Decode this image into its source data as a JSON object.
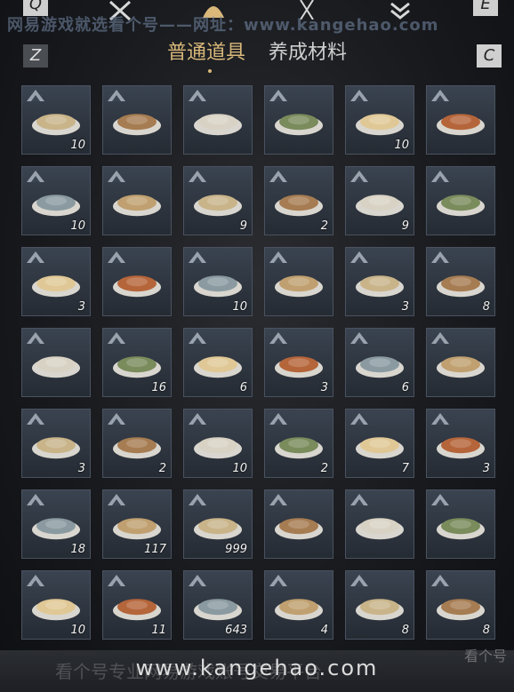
{
  "top": {
    "key_left": "Q",
    "key_right": "E",
    "watermark": "网易游戏就选看个号——网址：www.kangehao.com"
  },
  "tabs": {
    "key_left": "Z",
    "key_right": "C",
    "items": [
      {
        "label": "普通道具",
        "active": true
      },
      {
        "label": "养成材料",
        "active": false
      }
    ]
  },
  "inventory": [
    {
      "name": "plate-flatbread",
      "count": "10"
    },
    {
      "name": "braised-stew-bowl",
      "count": ""
    },
    {
      "name": "oyster-plate",
      "count": ""
    },
    {
      "name": "green-vegetable-bowl",
      "count": ""
    },
    {
      "name": "scallion-pancake",
      "count": "10"
    },
    {
      "name": "steamed-bun",
      "count": ""
    },
    {
      "name": "noodle-bowl",
      "count": "10"
    },
    {
      "name": "stir-fried-noodles",
      "count": ""
    },
    {
      "name": "fried-meat-plate",
      "count": "9"
    },
    {
      "name": "spinach-plate",
      "count": "2"
    },
    {
      "name": "rice-ball-bowl",
      "count": "9"
    },
    {
      "name": "soup-bowl",
      "count": ""
    },
    {
      "name": "braised-pork-bowl",
      "count": "3"
    },
    {
      "name": "broth-bowl",
      "count": ""
    },
    {
      "name": "tofu-plate",
      "count": "10"
    },
    {
      "name": "sliced-meat-plate",
      "count": ""
    },
    {
      "name": "porridge-bowl",
      "count": "3"
    },
    {
      "name": "white-wine-bottle",
      "count": "8"
    },
    {
      "name": "blue-wine-bottle",
      "count": ""
    },
    {
      "name": "noodle-plate",
      "count": "16"
    },
    {
      "name": "fish-plate",
      "count": "6"
    },
    {
      "name": "spicy-chicken-bowl",
      "count": "3"
    },
    {
      "name": "clay-pot-stew",
      "count": "6"
    },
    {
      "name": "roast-meat-plate",
      "count": ""
    },
    {
      "name": "egg-soup-bowl",
      "count": "3"
    },
    {
      "name": "meatballs",
      "count": "2"
    },
    {
      "name": "fried-chicken-plate",
      "count": "10"
    },
    {
      "name": "tofu-cubes",
      "count": "2"
    },
    {
      "name": "layered-pancake",
      "count": "7"
    },
    {
      "name": "dumpling-board",
      "count": "3"
    },
    {
      "name": "paper-scroll",
      "count": "18"
    },
    {
      "name": "porcelain-jar",
      "count": "117"
    },
    {
      "name": "gift-box",
      "count": "999"
    },
    {
      "name": "zongzi-basket",
      "count": ""
    },
    {
      "name": "torch-stick",
      "count": ""
    },
    {
      "name": "green-fruit-tray",
      "count": ""
    },
    {
      "name": "folded-letter",
      "count": "10"
    },
    {
      "name": "paper-lantern",
      "count": "11"
    },
    {
      "name": "war-horn",
      "count": "643"
    },
    {
      "name": "red-envelope",
      "count": "4"
    },
    {
      "name": "rolled-scroll",
      "count": "8"
    },
    {
      "name": "white-egg",
      "count": "8"
    }
  ],
  "bottom": {
    "watermark_cn": "看个号专业网易游戏账号交易平台",
    "watermark_url": "www.kangehao.com",
    "logo": "看个号"
  },
  "colors": {
    "accent": "#d9b87a",
    "slot_bg": "#2f3640",
    "count_text": "#f2f2f2"
  }
}
